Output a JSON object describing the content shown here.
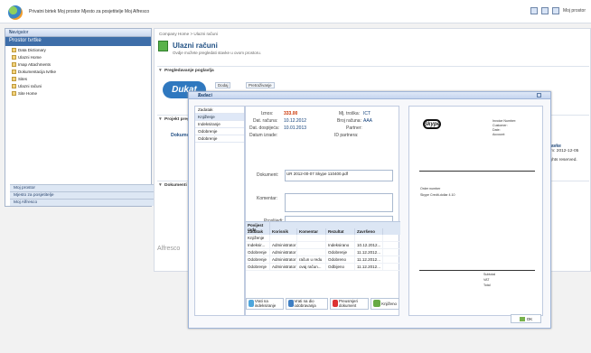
{
  "app": {
    "title": "Privatni birtek  Moj prostor  Mjesto za posjetitelje  Moj Alfresco",
    "right_links": [
      "Moj prostor"
    ]
  },
  "sidebar": {
    "title": "Navigator",
    "tab": "Prostor tvrtke",
    "items": [
      "Data Dictionary",
      "Ulazni Home",
      "Imap Attachments",
      "Dokumentacija tvrtke",
      "Sites",
      "Ulazni računi",
      "Site Home"
    ],
    "bottom": [
      "Moj prostor",
      "Mjesto za posjetitelje",
      "Moj Alfresco"
    ]
  },
  "main": {
    "breadcrumb": "Company Home > Ulazni računi",
    "title": "Ulazni računi",
    "description": "Ovdje možete pregledati stavke u ovom prostoru.",
    "section1": "Pregledavanje poglavlja",
    "section2": "Projekt pregled",
    "section3": "Dokumenti",
    "brand": "Dukat",
    "toolbar": [
      "Dodaj",
      "Pretraživanje"
    ],
    "left_item_title": "Dokument",
    "right_item_title": "Postavke",
    "right_item_date": "Datum: 2012-12-05",
    "footer": "Alfresco",
    "copyright": "All rights reserved."
  },
  "dialog": {
    "title": "Zadaci",
    "tabs": [
      "Zadatak",
      "Knjiženje",
      "Indeksiranje",
      "Odobrenje",
      "Odobrenje"
    ],
    "iznos_label": "Iznos:",
    "iznos_value": "333.00",
    "dat_label": "Dat. računa:",
    "dat_value": "10.12.2012",
    "dospijece_label": "Dat. dospijeća:",
    "dospijece_value": "10.01.2013",
    "status_label": "Datum izrade:",
    "trosak_label": "Mj. troška:",
    "trosak_value": "ICT",
    "brojr_label": "Broj računa:",
    "brojr_value": "AAA",
    "partner_label": "Partner:",
    "partner2_label": "ID partnera:",
    "dokument_label": "Dokument:",
    "dokument_value": "UR 2012-00-07 Skype 110400.pdf",
    "komentar_label": "Komentar:",
    "prosljedi_label": "Proslijedi:",
    "table_title": "Povijest rada",
    "columns": [
      "Zadatak",
      "Korisnik",
      "Komentar",
      "Rezultat",
      "Završeno"
    ],
    "rows": [
      [
        "Knjiženje",
        "",
        "",
        "",
        ""
      ],
      [
        "Indeksir...",
        "Administrator",
        "",
        "Indeksirano",
        "10.12.2012..."
      ],
      [
        "Odobrenje",
        "Administrator",
        "",
        "Odobrenje",
        "11.12.2012..."
      ],
      [
        "Odobrenje",
        "Administrator",
        "račun u redu",
        "Odobreno",
        "11.12.2012..."
      ],
      [
        "Odobrenje",
        "Administrator",
        "ovaj račun...",
        "Odbijeno",
        "11.12.2012..."
      ]
    ],
    "actions": [
      "Vrati na indeksiranje",
      "Vrati na dio odobravanja",
      "Preusmjeri dokument",
      "Knjiženo"
    ],
    "ok": "OK"
  },
  "invoice": {
    "brand": "Skype",
    "header": [
      "Invoice Number:",
      "Customer:",
      "Date:",
      "Account:"
    ],
    "items": [
      "Skype Credit-dollar 4.10",
      "Order number"
    ],
    "totals": [
      "Subtotal",
      "VAT",
      "Total"
    ]
  }
}
